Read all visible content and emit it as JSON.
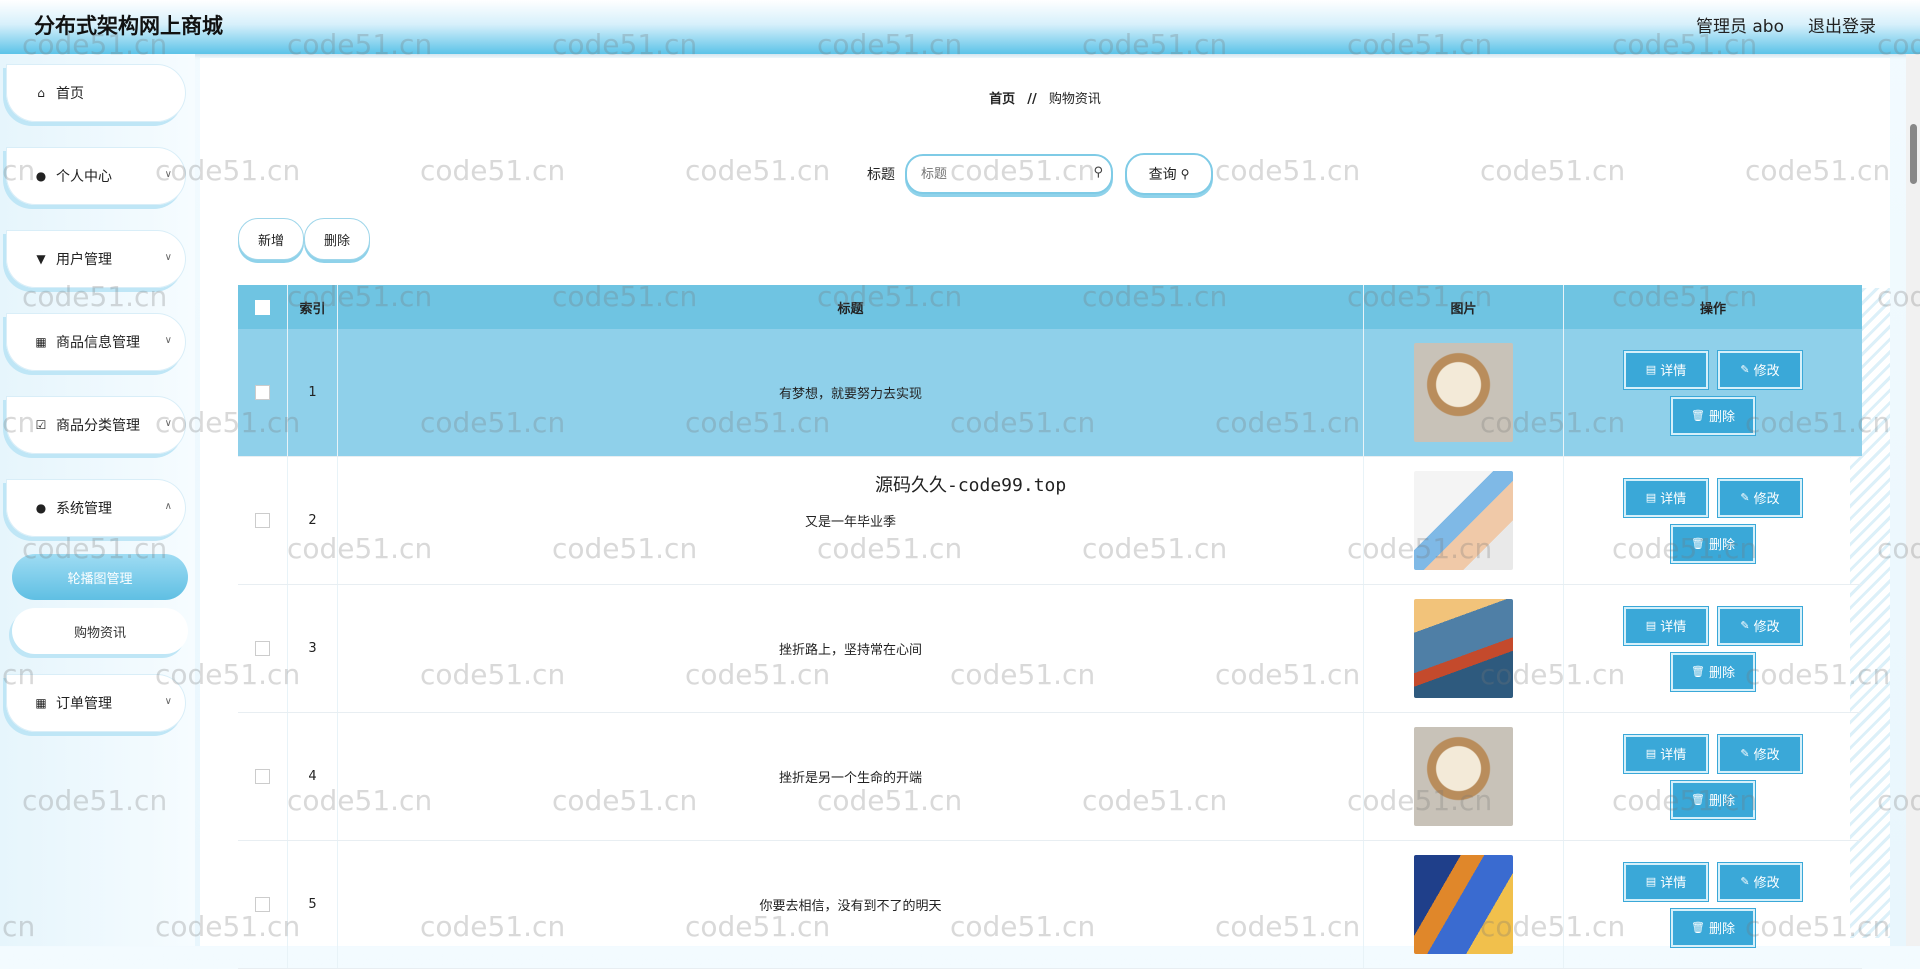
{
  "header": {
    "title": "分布式架构网上商城",
    "user": "管理员 abo",
    "logout": "退出登录"
  },
  "sidebar": {
    "items": [
      {
        "label": "首页",
        "icon": "home-icon",
        "chevron": false
      },
      {
        "label": "个人中心",
        "icon": "person-icon",
        "chevron": true
      },
      {
        "label": "用户管理",
        "icon": "user-manage-icon",
        "chevron": true
      },
      {
        "label": "商品信息管理",
        "icon": "grid-icon",
        "chevron": true
      },
      {
        "label": "商品分类管理",
        "icon": "category-icon",
        "chevron": true
      },
      {
        "label": "系统管理",
        "icon": "person-icon",
        "chevron": true
      },
      {
        "label": "订单管理",
        "icon": "grid-icon",
        "chevron": true
      }
    ],
    "subitems": [
      {
        "label": "轮播图管理",
        "active": true
      },
      {
        "label": "购物资讯",
        "active": false
      }
    ]
  },
  "breadcrumb": {
    "home": "首页",
    "sep": "//",
    "current": "购物资讯"
  },
  "search": {
    "label": "标题",
    "placeholder": "标题",
    "button": "查询"
  },
  "actions": {
    "add": "新增",
    "delete": "删除"
  },
  "table": {
    "headers": {
      "index": "索引",
      "title": "标题",
      "image": "图片",
      "ops": "操作"
    },
    "op_labels": {
      "detail": "详情",
      "edit": "修改",
      "delete": "删除"
    },
    "rows": [
      {
        "index": "1",
        "title": "有梦想，就要努力去实现",
        "selected": true,
        "image": "oats"
      },
      {
        "index": "2",
        "title": "又是一年毕业季",
        "selected": false,
        "image": "cartoon"
      },
      {
        "index": "3",
        "title": "挫折路上，坚持常在心间",
        "selected": false,
        "image": "boat"
      },
      {
        "index": "4",
        "title": "挫折是另一个生命的开端",
        "selected": false,
        "image": "oats"
      },
      {
        "index": "5",
        "title": "你要去相信，没有到不了的明天",
        "selected": false,
        "image": "city"
      }
    ]
  },
  "overlay_text": "源码久久-code99.top",
  "watermark": "code51.cn"
}
